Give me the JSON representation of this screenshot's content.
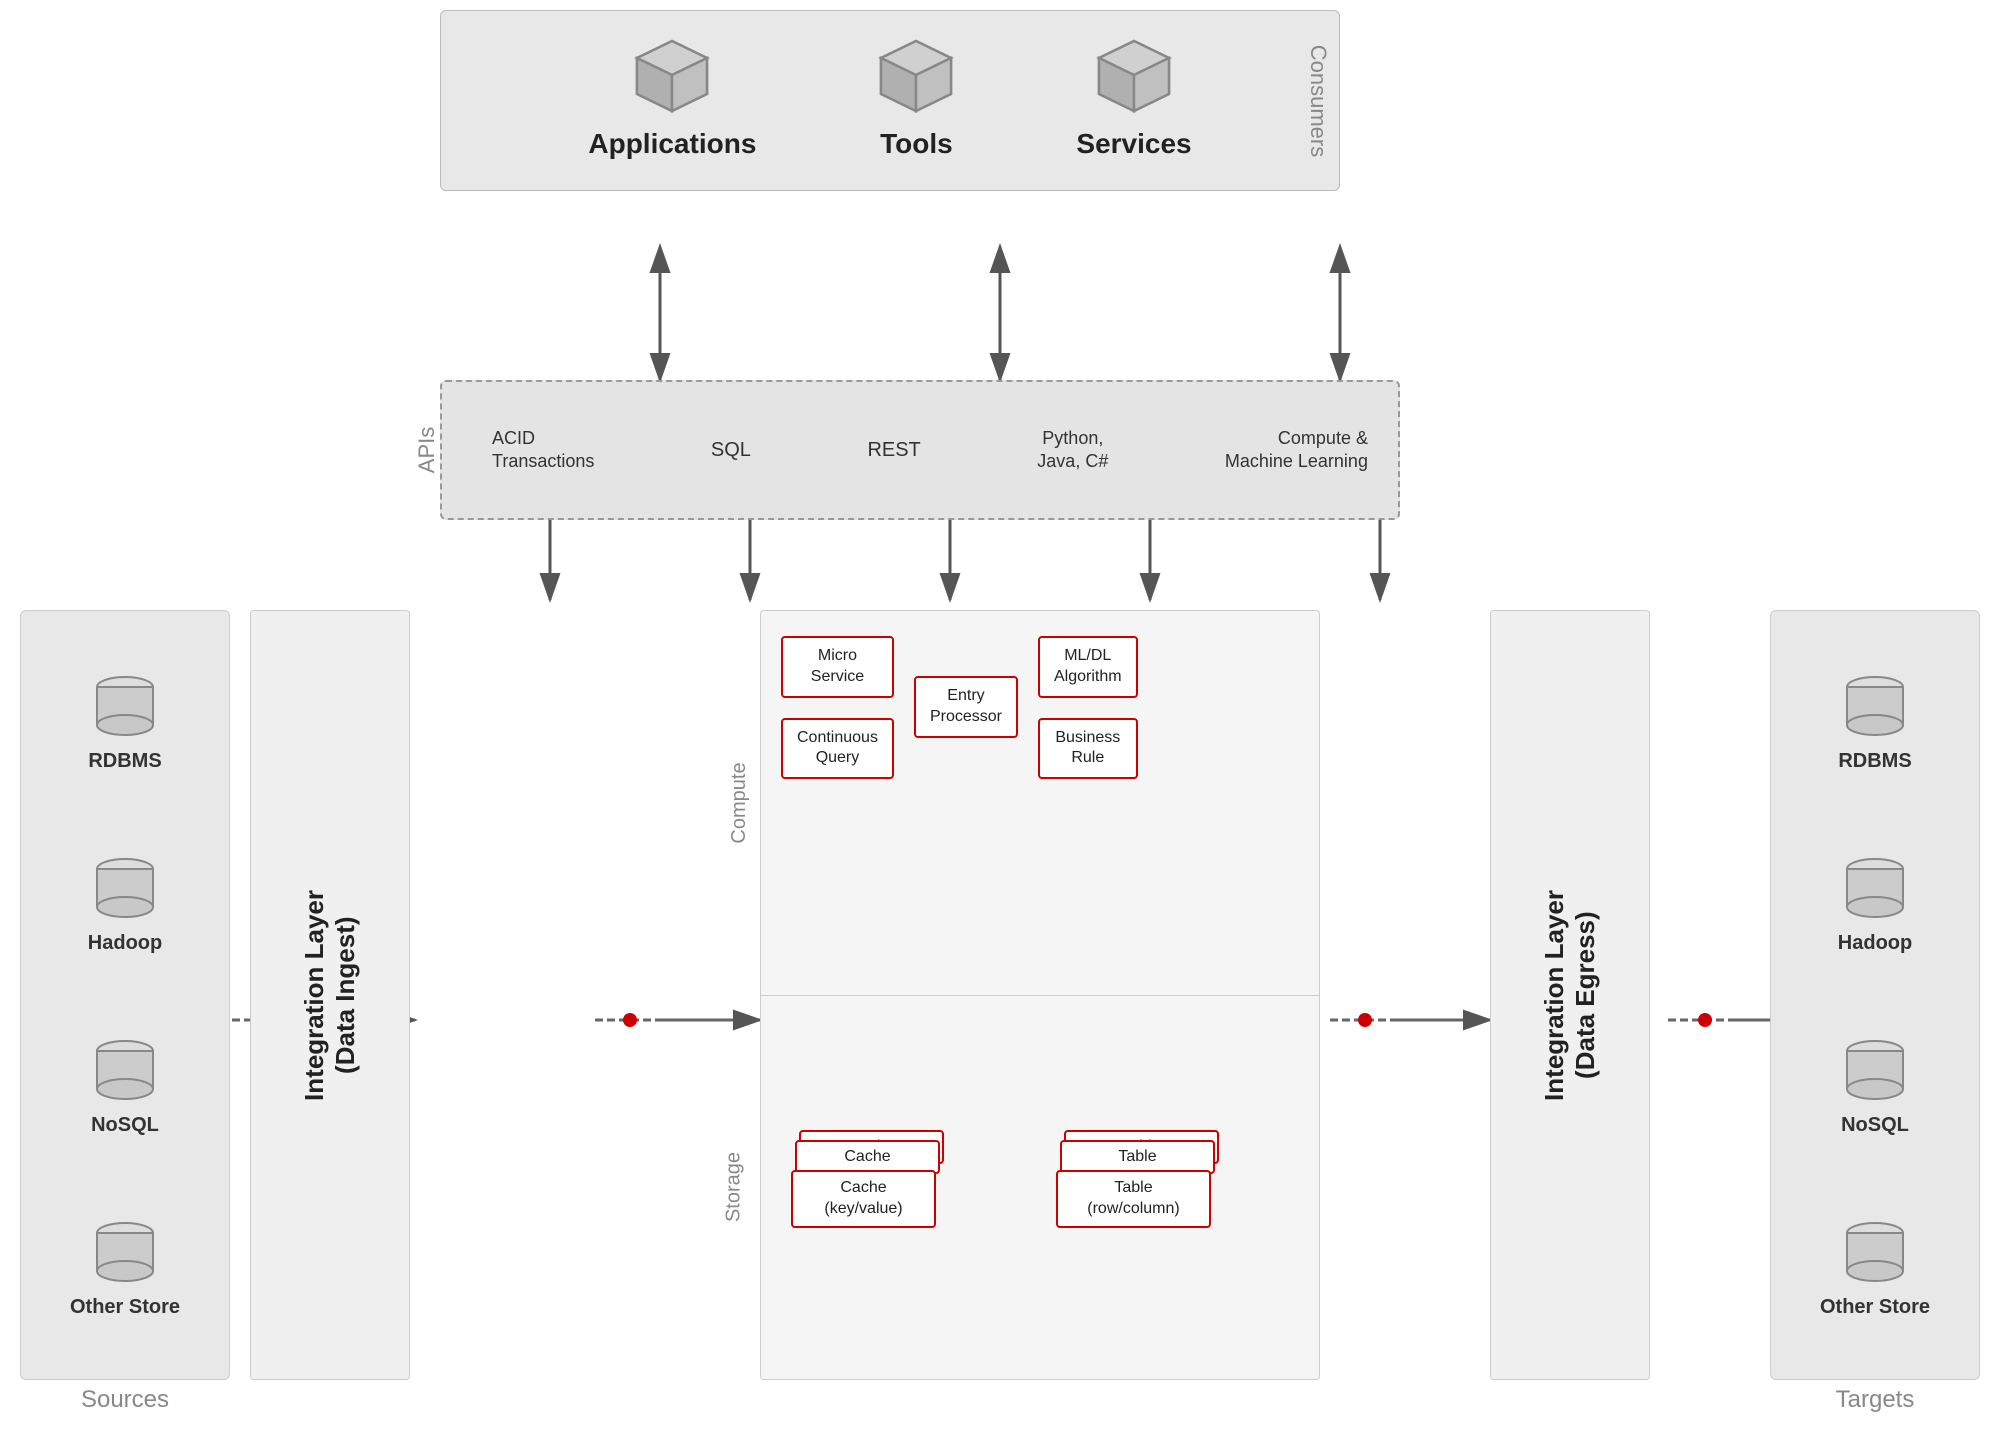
{
  "consumers": {
    "label": "Consumers",
    "items": [
      {
        "id": "applications",
        "label": "Applications"
      },
      {
        "id": "tools",
        "label": "Tools"
      },
      {
        "id": "services",
        "label": "Services"
      }
    ]
  },
  "apis": {
    "label": "APIs",
    "items": [
      {
        "id": "acid",
        "line1": "ACID",
        "line2": "Transactions"
      },
      {
        "id": "sql",
        "label": "SQL"
      },
      {
        "id": "rest",
        "label": "REST"
      },
      {
        "id": "python",
        "line1": "Python,",
        "line2": "Java, C#"
      },
      {
        "id": "compute",
        "line1": "Compute &",
        "line2": "Machine Learning"
      }
    ]
  },
  "sources": {
    "label": "Sources",
    "items": [
      {
        "id": "rdbms",
        "label": "RDBMS"
      },
      {
        "id": "hadoop",
        "label": "Hadoop"
      },
      {
        "id": "nosql",
        "label": "NoSQL"
      },
      {
        "id": "other",
        "label": "Other Store"
      }
    ]
  },
  "targets": {
    "label": "Targets",
    "items": [
      {
        "id": "rdbms",
        "label": "RDBMS"
      },
      {
        "id": "hadoop",
        "label": "Hadoop"
      },
      {
        "id": "nosql",
        "label": "NoSQL"
      },
      {
        "id": "other",
        "label": "Other Store"
      }
    ]
  },
  "integration_ingest": {
    "line1": "Integration Layer",
    "line2": "(Data Ingest)"
  },
  "integration_egress": {
    "line1": "Integration Layer",
    "line2": "(Data Egress)"
  },
  "compute": {
    "label": "Compute",
    "items": [
      {
        "id": "micro-service",
        "label": "Micro\nService"
      },
      {
        "id": "entry-processor",
        "label": "Entry\nProcessor"
      },
      {
        "id": "continuous-query",
        "label": "Continuous\nQuery"
      },
      {
        "id": "ml-dl",
        "label": "ML/DL\nAlgorithm"
      },
      {
        "id": "business-rule",
        "label": "Business\nRule"
      }
    ]
  },
  "storage": {
    "label": "Storage",
    "cache_label": "Cache\n(key/value)",
    "table_label": "Table\n(row/column)",
    "items": [
      {
        "id": "cache1",
        "label": "Cache"
      },
      {
        "id": "cache2",
        "label": "Cache"
      },
      {
        "id": "cache3",
        "label": "Cache\n(key/value)"
      },
      {
        "id": "table1",
        "label": "Table"
      },
      {
        "id": "table2",
        "label": "Table"
      },
      {
        "id": "table3",
        "label": "Table\n(row/column)"
      }
    ]
  },
  "colors": {
    "background": "#f0f0f0",
    "panel": "#e8e8e8",
    "red": "#cc0000",
    "text_dark": "#222222",
    "text_light": "#888888",
    "border": "#cccccc",
    "arrow": "#555555"
  }
}
